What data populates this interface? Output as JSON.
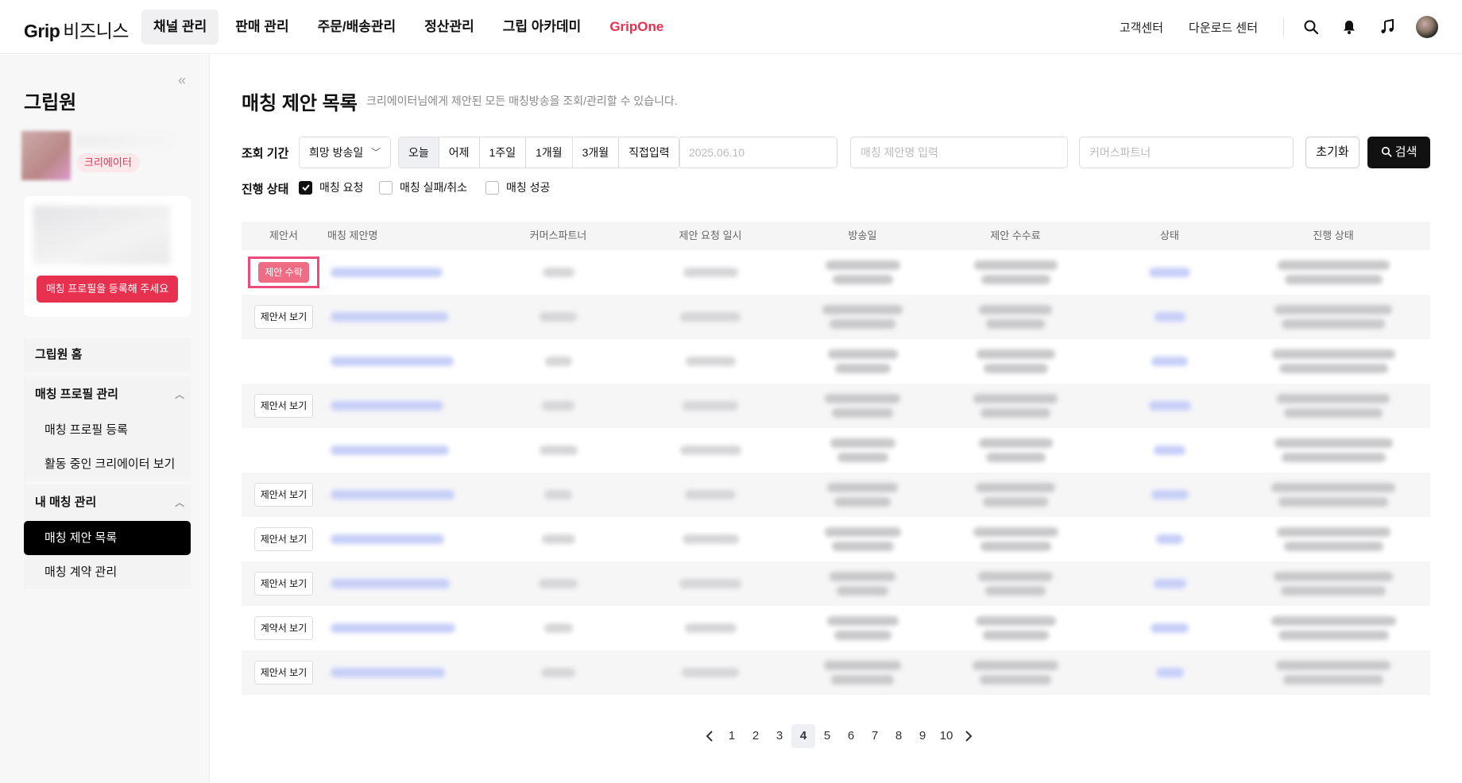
{
  "topnav": {
    "logo_main": "Grip",
    "logo_sub": "비즈니스",
    "menu": [
      "채널 관리",
      "판매 관리",
      "주문/배송관리",
      "정산관리",
      "그립 아카데미",
      "GripOne"
    ],
    "active_index": 0,
    "links": [
      "고객센터",
      "다운로드 센터"
    ]
  },
  "sidebar": {
    "title": "그립원",
    "role_badge": "크리에이터",
    "register_button": "매칭 프로필을 등록해 주세요",
    "home": "그립원 홈",
    "groups": [
      {
        "label": "매칭 프로필 관리",
        "items": [
          "매칭 프로필 등록",
          "활동 중인 크리에이터 보기"
        ]
      },
      {
        "label": "내 매칭 관리",
        "items": [
          "매칭 제안 목록",
          "매칭 계약 관리"
        ]
      }
    ],
    "active_item": "매칭 제안 목록"
  },
  "page": {
    "title": "매칭 제안 목록",
    "description": "크리에이터님에게 제안된 모든 매칭방송을 조회/관리할 수 있습니다."
  },
  "filters": {
    "period_label": "조회 기간",
    "date_type": "희망 방송일",
    "ranges": [
      "오늘",
      "어제",
      "1주일",
      "1개월",
      "3개월",
      "직접입력"
    ],
    "active_range": "오늘",
    "date_value": "2025.06.10",
    "name_placeholder": "매칭 제안명 입력",
    "partner_placeholder": "커머스파트너",
    "reset_label": "초기화",
    "search_label": "검색",
    "status_label": "진행 상태",
    "statuses": [
      {
        "label": "매칭 요청",
        "checked": true
      },
      {
        "label": "매칭 실패/취소",
        "checked": false
      },
      {
        "label": "매칭 성공",
        "checked": false
      }
    ]
  },
  "table": {
    "columns": [
      "제안서",
      "매칭 제안명",
      "커머스파트너",
      "제안 요청 일시",
      "방송일",
      "제안 수수료",
      "상태",
      "진행 상태"
    ],
    "rows": [
      {
        "action": "제안 수락",
        "action_type": "accept"
      },
      {
        "action": "제안서 보기",
        "action_type": "view"
      },
      {
        "action": "",
        "action_type": "none"
      },
      {
        "action": "제안서 보기",
        "action_type": "view"
      },
      {
        "action": "",
        "action_type": "none"
      },
      {
        "action": "제안서 보기",
        "action_type": "view"
      },
      {
        "action": "제안서 보기",
        "action_type": "view"
      },
      {
        "action": "제안서 보기",
        "action_type": "view"
      },
      {
        "action": "계약서 보기",
        "action_type": "view"
      },
      {
        "action": "제안서 보기",
        "action_type": "view"
      }
    ]
  },
  "pagination": {
    "pages": [
      "1",
      "2",
      "3",
      "4",
      "5",
      "6",
      "7",
      "8",
      "9",
      "10"
    ],
    "current": "4"
  },
  "colors": {
    "brand": "#e8304f",
    "highlight": "#e94c7a",
    "dark": "#111111"
  }
}
